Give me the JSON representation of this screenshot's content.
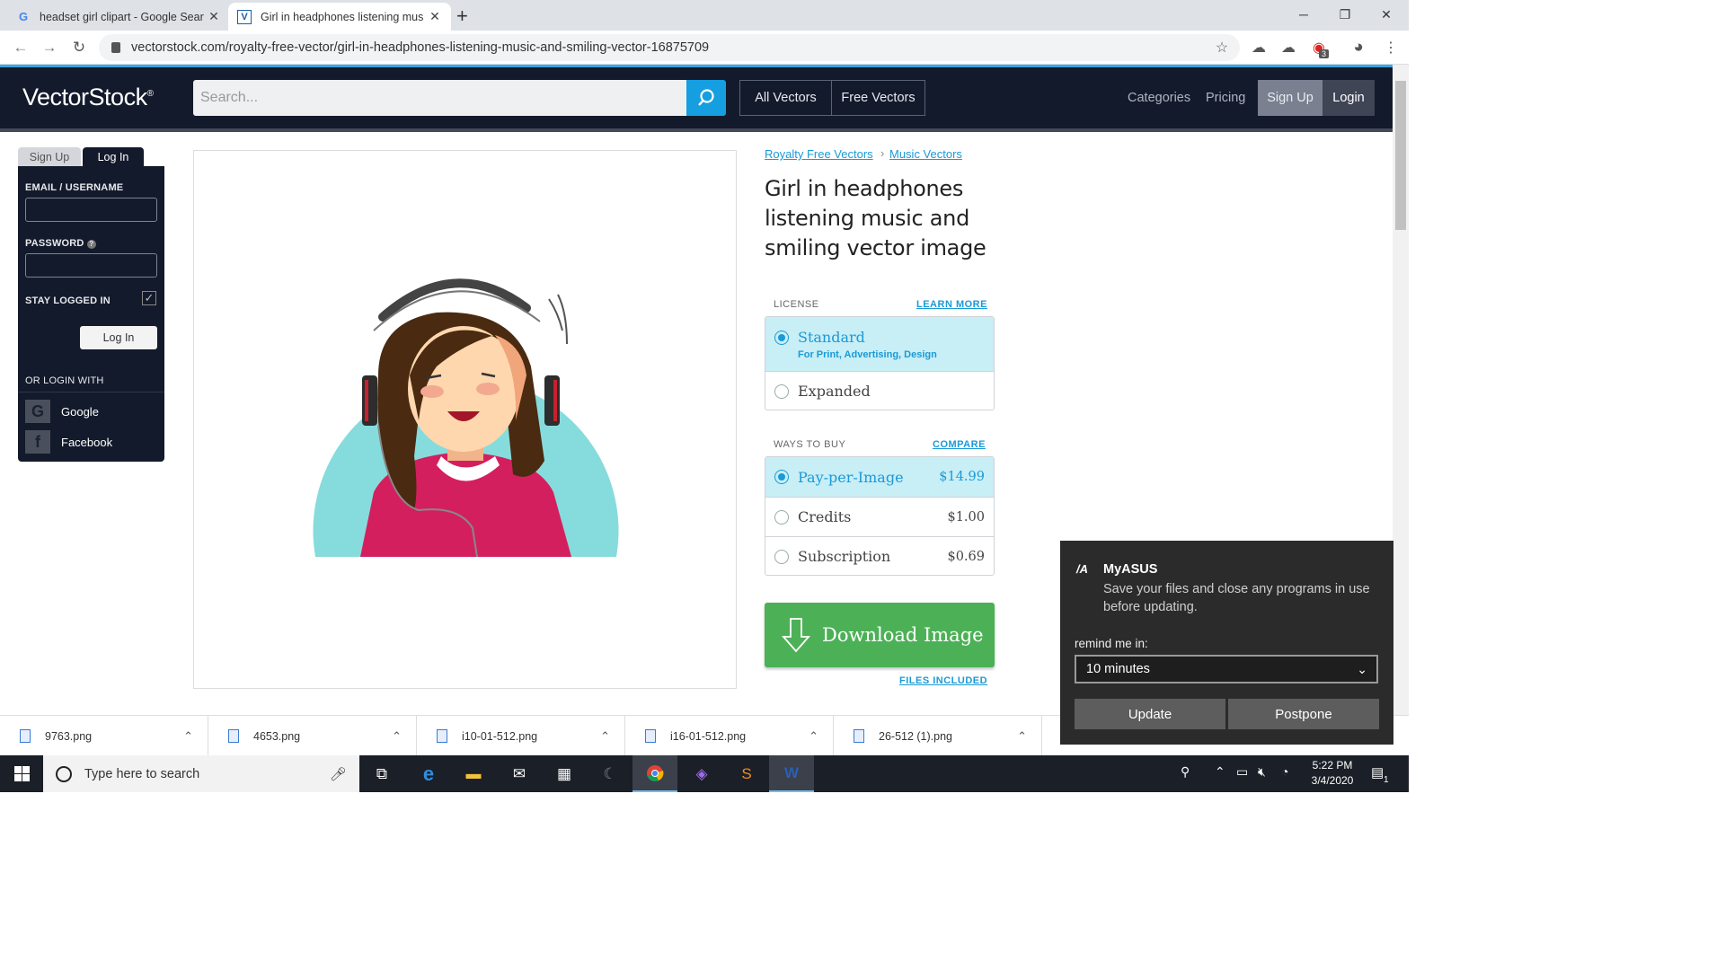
{
  "browser": {
    "tabs": [
      {
        "title": "headset girl clipart - Google Sear",
        "favicon": "G"
      },
      {
        "title": "Girl in headphones listening mus",
        "favicon": "V"
      }
    ],
    "url": "vectorstock.com/royalty-free-vector/girl-in-headphones-listening-music-and-smiling-vector-16875709",
    "extension_badge": "3"
  },
  "site": {
    "logo": "VectorStock",
    "logo_mark": "®",
    "search_placeholder": "Search...",
    "nav": {
      "all_vectors": "All Vectors",
      "free_vectors": "Free Vectors",
      "categories": "Categories",
      "pricing": "Pricing",
      "sign_up": "Sign Up",
      "login": "Login"
    }
  },
  "login_panel": {
    "tab_signup": "Sign Up",
    "tab_login": "Log In",
    "email_label": "EMAIL / USERNAME",
    "password_label": "PASSWORD",
    "stay_logged_in": "STAY LOGGED IN",
    "login_button": "Log In",
    "or_login_with": "OR LOGIN WITH",
    "google": "Google",
    "facebook": "Facebook"
  },
  "product": {
    "breadcrumb": [
      "Royalty Free Vectors",
      "Music Vectors"
    ],
    "breadcrumb_sep": "›",
    "title": "Girl in headphones listening music and smiling vector image",
    "license_label": "LICENSE",
    "learn_more": "LEARN MORE",
    "licenses": [
      {
        "name": "Standard",
        "sub": "For Print, Advertising, Design",
        "selected": true
      },
      {
        "name": "Expanded",
        "selected": false
      }
    ],
    "ways_label": "WAYS TO BUY",
    "compare": "COMPARE",
    "ways": [
      {
        "name": "Pay-per-Image",
        "price": "$14.99",
        "selected": true
      },
      {
        "name": "Credits",
        "price": "$1.00",
        "selected": false
      },
      {
        "name": "Subscription",
        "price": "$0.69",
        "selected": false
      }
    ],
    "download": "Download Image",
    "files_included": "FILES INCLUDED"
  },
  "downloads": [
    {
      "name": "9763.png"
    },
    {
      "name": "4653.png"
    },
    {
      "name": "i10-01-512.png"
    },
    {
      "name": "i16-01-512.png"
    },
    {
      "name": "26-512 (1).png"
    }
  ],
  "notification": {
    "app": "MyASUS",
    "message": "Save your files and close any programs in use before updating.",
    "remind_label": "remind me in:",
    "remind_value": "10 minutes",
    "update": "Update",
    "postpone": "Postpone"
  },
  "taskbar": {
    "search_placeholder": "Type here to search",
    "time": "5:22 PM",
    "date": "3/4/2020",
    "notification_count": "1"
  },
  "colors": {
    "accent": "#1a9ad6",
    "header_bg": "#131a2b",
    "download_green": "#4cb156",
    "illustration_teal": "#86dcdc",
    "shirt_pink": "#d41f5f"
  }
}
